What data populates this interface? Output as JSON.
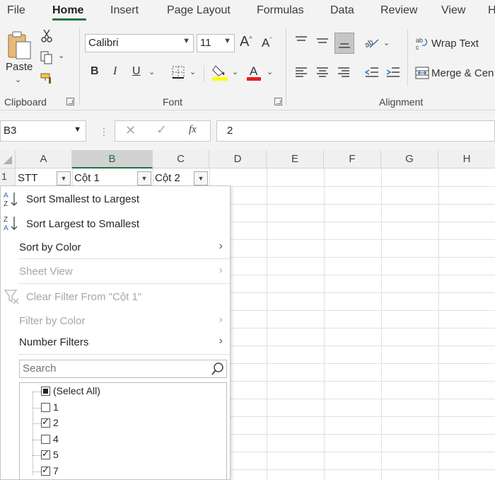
{
  "tabs": [
    {
      "label": "File"
    },
    {
      "label": "Home"
    },
    {
      "label": "Insert"
    },
    {
      "label": "Page Layout"
    },
    {
      "label": "Formulas"
    },
    {
      "label": "Data"
    },
    {
      "label": "Review"
    },
    {
      "label": "View"
    },
    {
      "label": "H"
    }
  ],
  "active_tab": "Home",
  "ribbon": {
    "clipboard": {
      "paste_label": "Paste",
      "group_label": "Clipboard"
    },
    "font": {
      "font_name": "Calibri",
      "font_size": "11",
      "group_label": "Font",
      "bold": "B",
      "italic": "I",
      "underline": "U"
    },
    "alignment": {
      "wrap_text": "Wrap Text",
      "merge": "Merge & Cen",
      "group_label": "Alignment"
    }
  },
  "formula_bar": {
    "name_box": "B3",
    "formula": "2",
    "fx": "fx"
  },
  "grid": {
    "columns": [
      "A",
      "B",
      "C",
      "D",
      "E",
      "F",
      "G",
      "H"
    ],
    "selected_column": "B",
    "row1": {
      "num": "1",
      "a": "STT",
      "b": "Cột 1",
      "c": "Cột 2"
    }
  },
  "filter_menu": {
    "sort_asc": "Sort Smallest to Largest",
    "sort_desc": "Sort Largest to Smallest",
    "sort_color": "Sort by Color",
    "sheet_view": "Sheet View",
    "clear_filter": "Clear Filter From \"Cột 1\"",
    "filter_color": "Filter by Color",
    "number_filters": "Number Filters",
    "search_placeholder": "Search",
    "items": [
      {
        "label": "(Select All)",
        "state": "partial"
      },
      {
        "label": "1",
        "state": "unchecked"
      },
      {
        "label": "2",
        "state": "checked"
      },
      {
        "label": "4",
        "state": "unchecked"
      },
      {
        "label": "5",
        "state": "checked"
      },
      {
        "label": "7",
        "state": "checked"
      }
    ]
  },
  "colors": {
    "accent": "#217346",
    "ribbon_bg": "#f3f3f3",
    "highlight_yellow": "#ffff00",
    "font_red": "#e02020"
  }
}
